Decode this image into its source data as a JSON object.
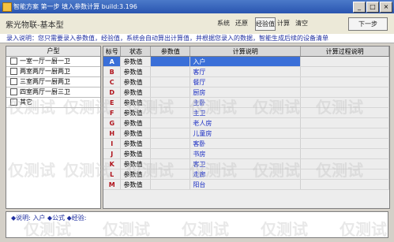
{
  "window": {
    "title": "智能方案 第一步 填入参数计算   build:3.196"
  },
  "header": {
    "subtitle": "紫光物联-基本型"
  },
  "toolbar": {
    "btn1": "系统",
    "btn2": "还原",
    "btn3": "经验值",
    "btn4": "计算",
    "btn5": "清空",
    "next": "下一步"
  },
  "info": {
    "text": "录入说明：您只需要录入参数值，经验值，系统会自动算出计算值，并根据您录入的数据，智能生成后续的设备清单"
  },
  "left": {
    "header": "户型",
    "items": [
      "一室一厅一厨一卫",
      "两室两厅一厨两卫",
      "三室两厅一厨两卫",
      "四室两厅一厨三卫",
      "其它"
    ]
  },
  "grid": {
    "headers": [
      "标号",
      "状态",
      "参数值",
      "计算说明",
      "计算过程说明"
    ],
    "rows": [
      {
        "id": "A",
        "status": "参数值",
        "value": "入户"
      },
      {
        "id": "B",
        "status": "参数值",
        "value": "客厅"
      },
      {
        "id": "C",
        "status": "参数值",
        "value": "餐厅"
      },
      {
        "id": "D",
        "status": "参数值",
        "value": "厨房"
      },
      {
        "id": "E",
        "status": "参数值",
        "value": "主卧"
      },
      {
        "id": "F",
        "status": "参数值",
        "value": "主卫"
      },
      {
        "id": "G",
        "status": "参数值",
        "value": "老人房"
      },
      {
        "id": "H",
        "status": "参数值",
        "value": "儿童房"
      },
      {
        "id": "I",
        "status": "参数值",
        "value": "客卧"
      },
      {
        "id": "J",
        "status": "参数值",
        "value": "书房"
      },
      {
        "id": "K",
        "status": "参数值",
        "value": "客卫"
      },
      {
        "id": "L",
        "status": "参数值",
        "value": "走廊"
      },
      {
        "id": "M",
        "status": "参数值",
        "value": "阳台"
      }
    ]
  },
  "footer": {
    "text": "◆说明: 入户  ◆公式  ◆经验:"
  },
  "watermark": {
    "text": "仅测试"
  },
  "colors": {
    "title_bar": "#2a55b0",
    "selection": "#3a6fd8",
    "info_text": "#2030a0",
    "id_text": "#b0121b"
  }
}
